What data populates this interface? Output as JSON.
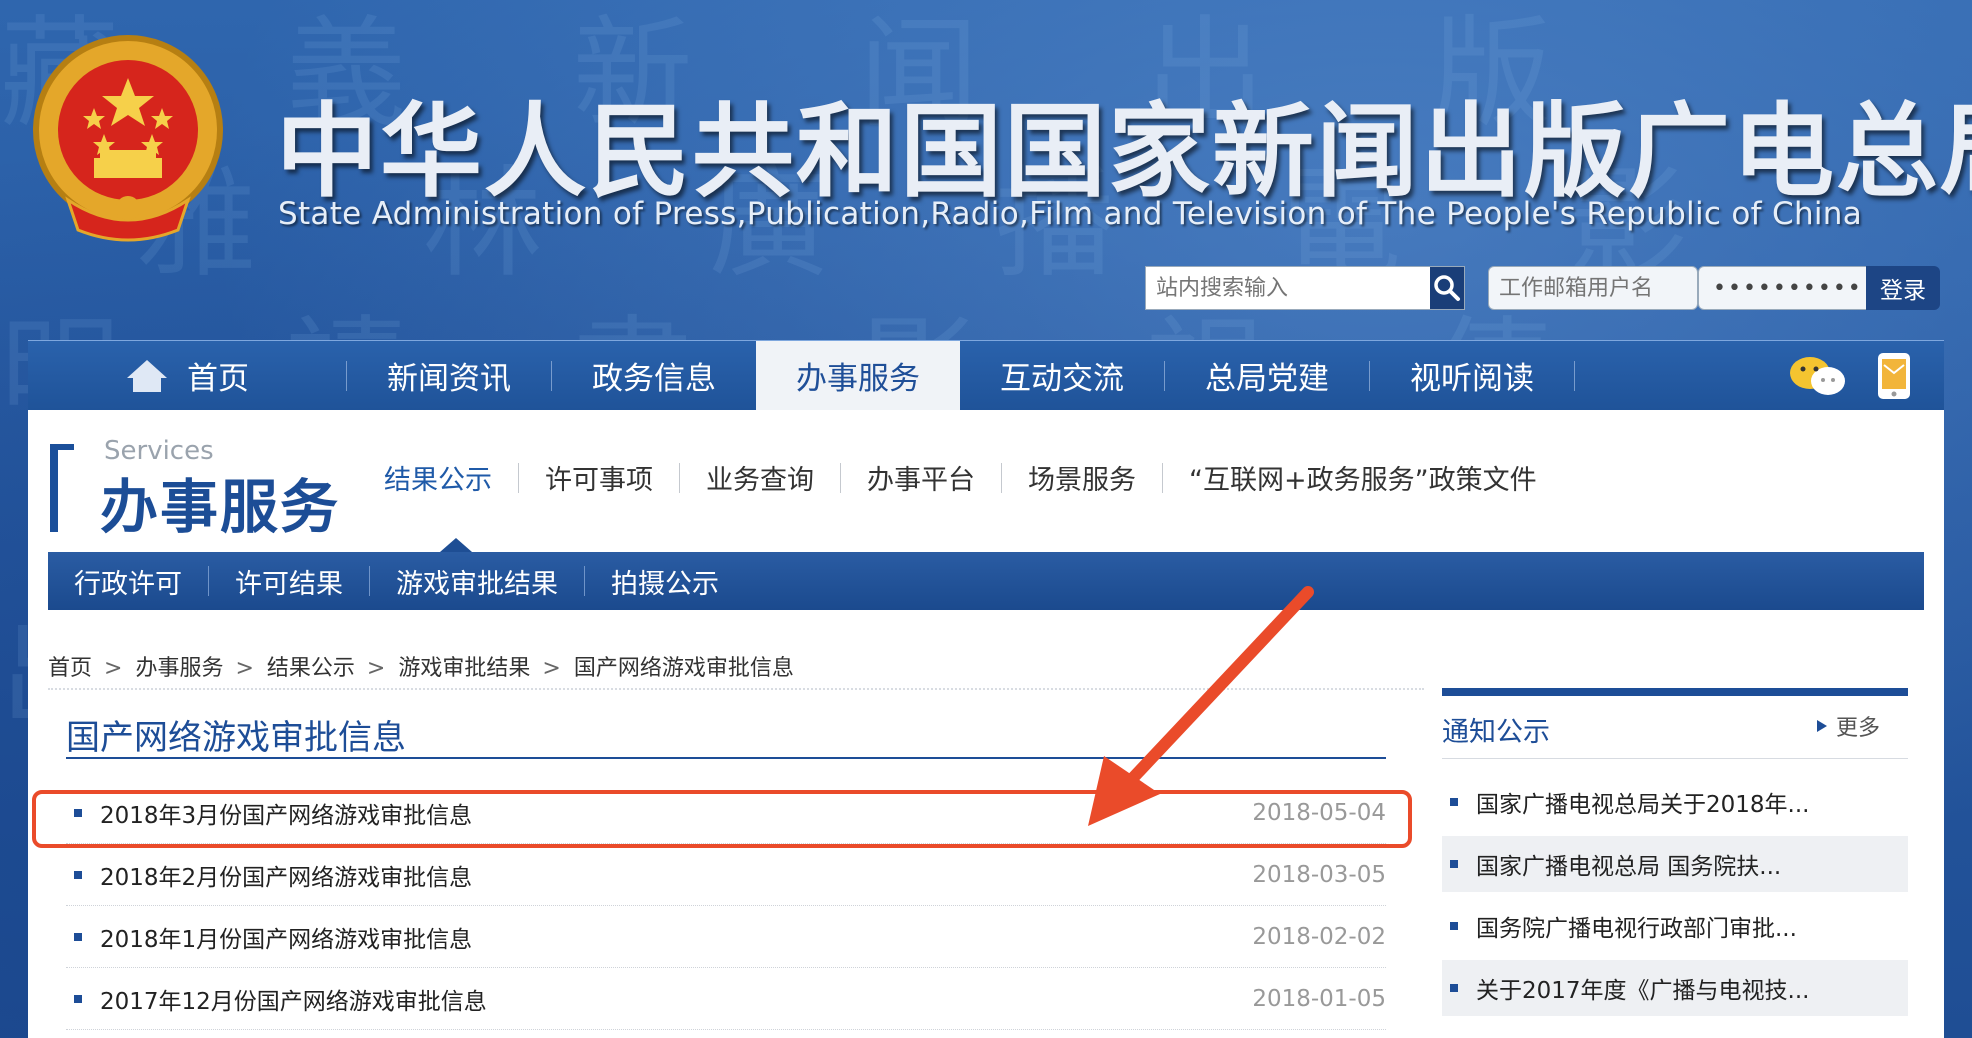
{
  "header": {
    "title": "中华人民共和国国家新闻出版广电总局",
    "subtitle": "State Administration of Press,Publication,Radio,Film and Television of The People's Republic of China",
    "search_placeholder": "站内搜索输入",
    "mail_placeholder": "工作邮箱用户名",
    "password_mask": "••••••••••",
    "login_label": "登录"
  },
  "main_nav": {
    "items": [
      {
        "label": "首页"
      },
      {
        "label": "新闻资讯"
      },
      {
        "label": "政务信息"
      },
      {
        "label": "办事服务"
      },
      {
        "label": "互动交流"
      },
      {
        "label": "总局党建"
      },
      {
        "label": "视听阅读"
      }
    ],
    "active_index": 3
  },
  "section": {
    "en": "Services",
    "cn": "办事服务",
    "sub_nav": [
      "结果公示",
      "许可事项",
      "业务查询",
      "办事平台",
      "场景服务",
      "“互联网+政务服务”政策文件"
    ],
    "tabs": [
      "行政许可",
      "许可结果",
      "游戏审批结果",
      "拍摄公示"
    ]
  },
  "breadcrumb": [
    "首页",
    "办事服务",
    "结果公示",
    "游戏审批结果",
    "国产网络游戏审批信息"
  ],
  "breadcrumb_sep": ">",
  "page_title": "国产网络游戏审批信息",
  "list": [
    {
      "title": "2018年3月份国产网络游戏审批信息",
      "date": "2018-05-04"
    },
    {
      "title": "2018年2月份国产网络游戏审批信息",
      "date": "2018-03-05"
    },
    {
      "title": "2018年1月份国产网络游戏审批信息",
      "date": "2018-02-02"
    },
    {
      "title": "2017年12月份国产网络游戏审批信息",
      "date": "2018-01-05"
    }
  ],
  "notices": {
    "title": "通知公示",
    "more_label": "更多",
    "items": [
      "国家广播电视总局关于2018年...",
      "国家广播电视总局 国务院扶...",
      "国务院广播电视行政部门审批...",
      "关于2017年度《广播与电视技..."
    ]
  },
  "colors": {
    "brand_blue": "#1d4d97",
    "highlight": "#ea4b2a"
  }
}
